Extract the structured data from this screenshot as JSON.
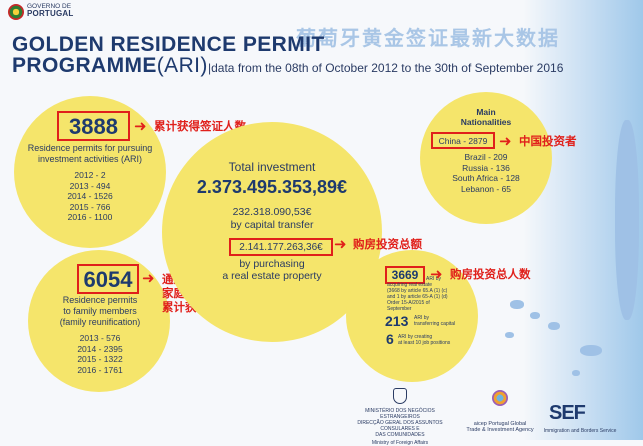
{
  "header": {
    "gov_line1": "GOVERNO DE",
    "gov_line2": "PORTUGAL",
    "title_line1": "GOLDEN RESIDENCE PERMIT",
    "title_line2_main": "PROGRAMME",
    "title_line2_ari": "(ARI)",
    "subtitle": "data from the 08th of October 2012 to the 30th of September 2016",
    "chinese_title": "葡萄牙黄金签证最新大数据"
  },
  "investment_permits": {
    "value": "3888",
    "label_line1": "Residence permits for pursuing",
    "label_line2": "investment activities (ARI)",
    "years": [
      "2012 - 2",
      "2013 - 494",
      "2014 - 1526",
      "2015 - 766",
      "2016 - 1100"
    ],
    "annotation": "累计获得签证人数"
  },
  "family_permits": {
    "value": "6054",
    "label_line1": "Residence permits",
    "label_line2": "to family members",
    "label_line3": "(family reunification)",
    "years": [
      "2013 - 576",
      "2014 - 2395",
      "2015 - 1322",
      "2016 - 1761"
    ],
    "annotation_line1": "通过申请",
    "annotation_line2": "家庭团聚",
    "annotation_line3": "累计获签人数"
  },
  "total_investment": {
    "heading": "Total investment",
    "value": "2.373.495.353,89€",
    "capital_value": "232.318.090,53€",
    "capital_label": "by capital transfer",
    "real_estate_value": "2.141.177.263,36€",
    "real_estate_label1": "by purchasing",
    "real_estate_label2": "a real estate property",
    "annotation": "购房投资总额"
  },
  "nationalities": {
    "heading1": "Main",
    "heading2": "Nationalities",
    "highlight": "China - 2879",
    "others": [
      "Brazil - 209",
      "Russia - 136",
      "South Africa - 128",
      "Lebanon - 65"
    ],
    "annotation": "中国投资者"
  },
  "ari_breakdown": {
    "value": "3669",
    "detail_lines": [
      "ARI by",
      "acquiring real estate",
      "(3668 by article 65.A (1) (c)",
      "and 1 by article 65-A (1) (d)",
      "Order 15-A/2015 of",
      "September"
    ],
    "capital_value": "213",
    "capital_label1": "ARI by",
    "capital_label2": "transferring capital",
    "jobs_value": "6",
    "jobs_label1": "ARI by creating",
    "jobs_label2": "at least 10 job positions",
    "annotation": "购房投资总人数"
  },
  "footer": {
    "mne_line1": "MINISTÉRIO DOS NEGÓCIOS ESTRANGEIROS",
    "mne_line2": "DIRECÇÃO GERAL DOS ASSUNTOS CONSULARES E",
    "mne_line3": "DAS COMUNIDADES",
    "mne_en": "Ministry of Foreign Affairs",
    "aicep": "aicep Portugal Global",
    "aicep_en": "Trade & Investment Agency",
    "sef": "SEF",
    "sef_en": "Immigration and Borders Service"
  },
  "colors": {
    "circle": "#f5e56b",
    "navy": "#1e3a6e",
    "annotation_red": "#e0201b"
  }
}
